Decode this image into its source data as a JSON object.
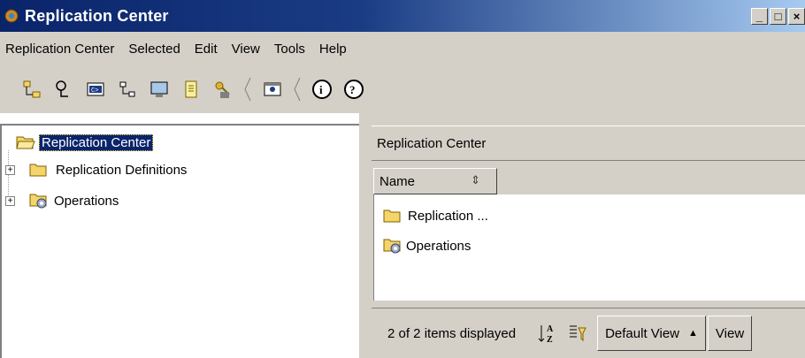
{
  "window": {
    "title": "Replication Center"
  },
  "menu": [
    "Replication Center",
    "Selected",
    "Edit",
    "View",
    "Tools",
    "Help"
  ],
  "toolbar": {
    "icons": [
      "tree-icon",
      "search-icon",
      "command-window-icon",
      "network-icon",
      "monitor-icon",
      "journal-icon",
      "license-icon",
      "task-center-icon",
      "info-icon",
      "help-icon"
    ]
  },
  "tree": {
    "root": "Replication Center",
    "children": [
      "Replication Definitions",
      "Operations"
    ]
  },
  "details": {
    "header": "Replication Center",
    "column": "Name",
    "rows": [
      "Replication ...",
      "Operations"
    ],
    "status": "2 of 2 items displayed",
    "view_label": "Default View",
    "view_button": "View"
  }
}
